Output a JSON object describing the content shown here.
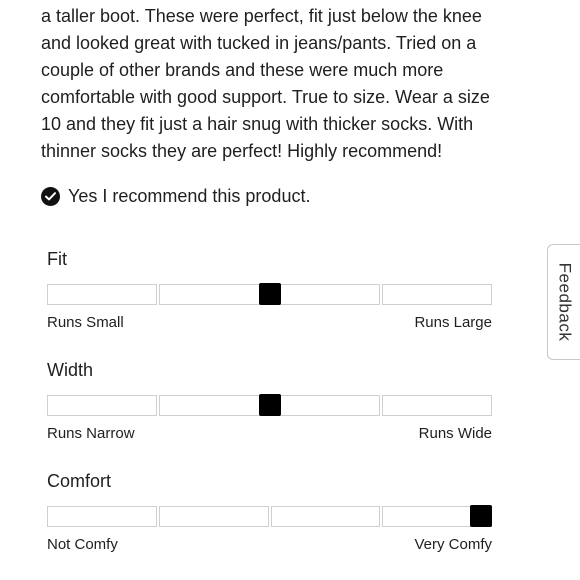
{
  "review": {
    "lines": [
      "a taller boot. These were perfect, fit just below the knee",
      "and looked great with tucked in jeans/pants. Tried on a",
      "couple of other brands and these were much more",
      "comfortable with good support. True to size. Wear a size",
      "10 and they fit just a hair snug with thicker socks. With",
      "thinner socks they are perfect! Highly recommend!"
    ]
  },
  "recommendation": {
    "icon": "check-circle-icon",
    "label": "Yes I recommend this product."
  },
  "ratings": [
    {
      "title": "Fit",
      "low_label": "Runs Small",
      "high_label": "Runs Large",
      "segments": 4,
      "value": 0.5
    },
    {
      "title": "Width",
      "low_label": "Runs Narrow",
      "high_label": "Runs Wide",
      "segments": 4,
      "value": 0.5
    },
    {
      "title": "Comfort",
      "low_label": "Not Comfy",
      "high_label": "Very Comfy",
      "segments": 4,
      "value": 1.0
    }
  ],
  "feedback_tab": {
    "label": "Feedback"
  },
  "colors": {
    "marker": "#000000",
    "segment_border": "#cfcfcf",
    "text": "#1f1f1f"
  }
}
